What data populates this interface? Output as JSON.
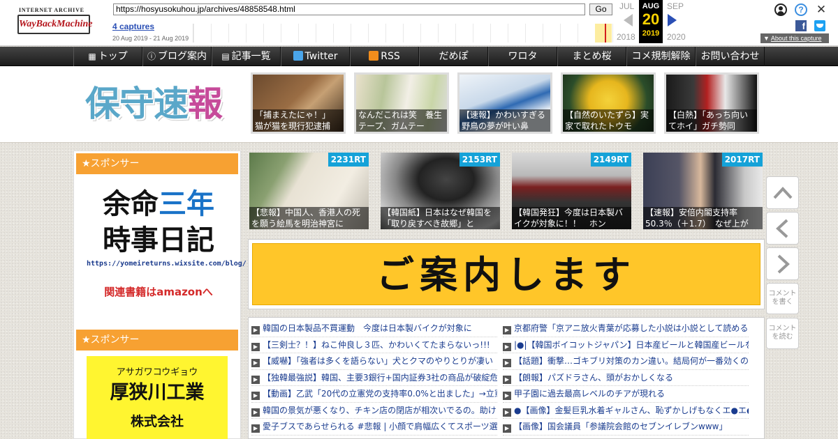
{
  "wayback": {
    "logo_top": "INTERNET ARCHIVE",
    "logo_main": "WayBackMachine",
    "url": "https://hosyusokuhou.jp/archives/48858548.html",
    "go_label": "Go",
    "captures_link": "4 captures",
    "capture_range": "20 Aug 2019 - 21 Aug 2019",
    "prev_month": "JUL",
    "current_month": "AUG",
    "current_day": "20",
    "next_month": "SEP",
    "prev_year": "2018",
    "current_year": "2019",
    "next_year": "2020",
    "help_glyph": "?",
    "close_glyph": "✕",
    "fb_glyph": "f",
    "about_label": "About this capture"
  },
  "nav": {
    "items": [
      {
        "label": "トップ"
      },
      {
        "label": "ブログ案内"
      },
      {
        "label": "記事一覧"
      },
      {
        "label": "Twitter"
      },
      {
        "label": "RSS"
      },
      {
        "label": "だめぽ"
      },
      {
        "label": "ワロタ"
      },
      {
        "label": "まとめ桜"
      },
      {
        "label": "コメ規制解除"
      },
      {
        "label": "お問い合わせ"
      }
    ]
  },
  "header": {
    "logo_chars": [
      "保",
      "守",
      "速",
      "報"
    ],
    "thumbs": [
      {
        "caption": "「捕まえたにゃ！」　猫が猫を現行犯逮捕"
      },
      {
        "caption": "なんだこれは笑　養生テープ、ガムテー"
      },
      {
        "caption": "【速報】かわいすぎる野鳥の夢が叶い鼻"
      },
      {
        "caption": "【自然のいたずら】実家で取れたトウモ"
      },
      {
        "caption": "【白熱】「あっち向いてホイ」ガチ勢同"
      }
    ]
  },
  "sidebar": {
    "sponsor1_label": "★スポンサー",
    "ad1_title_a": "余命",
    "ad1_title_b": "三年",
    "ad1_title_2": "時事日記",
    "ad1_url": "https://yomeireturns.wixsite.com/blog/",
    "ad1_link": "関連書籍はamazonへ",
    "sponsor2_label": "★スポンサー",
    "ad2_kana": "アサガワコウギョウ",
    "ad2_name": "厚狭川工業",
    "ad2_suffix": "株式会社"
  },
  "ranking": [
    {
      "rt": "2231RT",
      "caption": "【悲報】中国人、香港人の死を願う絵馬を明治神宮に"
    },
    {
      "rt": "2153RT",
      "caption": "【韓国紙】日本はなぜ韓国を「取り戻すべき故郷」と"
    },
    {
      "rt": "2149RT",
      "caption": "【韓国発狂】今度は日本製バイクが対象に！！　ホン"
    },
    {
      "rt": "2017RT",
      "caption": "【速報】安倍内閣支持率50.3％（＋1.7）　なぜ上が"
    }
  ],
  "banner": {
    "text": "ご案内します"
  },
  "articles": {
    "left": [
      "韓国の日本製品不買運動　今度は日本製バイクが対象に",
      "【三剣士？！】ねこ仲良し３匹、かわいくてたまらないっ!!!",
      "【威嚇】「強者は多くを語らない」犬とクマのやりとりが凄い",
      "【独韓最強説】韓国、主要3銀行+国内証券3社の商品が破綻危機",
      "【動画】乙武「20代の立憲党の支持率0.0%と出ました」→立憲・",
      "韓国の景気が悪くなり、チキン店の閉店が相次いでるの。助け",
      "愛子ブスであらせられる #悲報 | 小顔で肩幅広くてスポーツ選手"
    ],
    "right": [
      "京都府警「京アニ放火青葉が応募した小説は小説として読める",
      "|●|【韓国ボイコットジャパン】日本産ビールと韓国産ビールを",
      "【話題】衝撃…ゴキブリ対策のカン違い。結局何が一番効くの",
      "【朗報】パズドラさん、頭がおかしくなる",
      "甲子園に過去最高レベルのチアが現れる",
      "●【画像】金髪巨乳水着ギャルさん、恥ずかしげもなくエ●エ●",
      "【画像】国会議員「参議院会館のセブンイレブンwww」"
    ]
  },
  "side_buttons": {
    "write_comment": "コメントを書く",
    "read_comment": "コメントを読む"
  }
}
